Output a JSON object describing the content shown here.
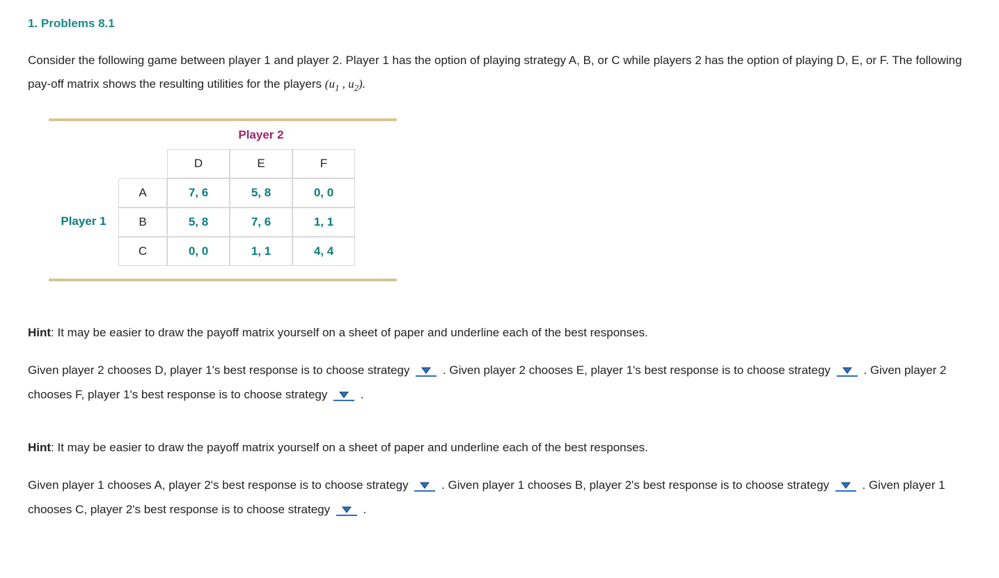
{
  "title": "1. Problems 8.1",
  "intro": {
    "part1": "Consider the following game between player 1 and player 2. Player 1 has the option of playing strategy A, B, or C while players 2 has the option of playing D, E, or F. The following pay-off matrix shows the resulting utilities for the players ",
    "math_open": "(",
    "u1": "u",
    "u1_sub": "1",
    "comma": " , ",
    "u2": "u",
    "u2_sub": "2",
    "math_close": ").",
    "part2": ""
  },
  "matrix": {
    "player1_label": "Player 1",
    "player2_label": "Player 2",
    "col_heads": [
      "D",
      "E",
      "F"
    ],
    "row_heads": [
      "A",
      "B",
      "C"
    ],
    "cells": [
      [
        "7, 6",
        "5, 8",
        "0, 0"
      ],
      [
        "5, 8",
        "7, 6",
        "1, 1"
      ],
      [
        "0, 0",
        "1, 1",
        "4, 4"
      ]
    ]
  },
  "hint1": {
    "label": "Hint",
    "text": ": It may be easier to draw the payoff matrix yourself on a sheet of paper and underline each of the best responses."
  },
  "q1": {
    "s1a": "Given player 2 chooses D, player 1's best response is to choose strategy ",
    "s1b": " . Given player 2 chooses E, player 1's best response is to choose strategy ",
    "s1c": " . Given player 2 chooses F, player 1's best response is to choose strategy ",
    "s1d": " ."
  },
  "hint2": {
    "label": "Hint",
    "text": ": It may be easier to draw the payoff matrix yourself on a sheet of paper and underline each of the best responses."
  },
  "q2": {
    "s1a": "Given player 1 chooses A, player 2's best response is to choose strategy ",
    "s1b": " . Given player 1 chooses B, player 2's best response is to choose strategy ",
    "s1c": " . Given player 1 chooses C, player 2's best response is to choose strategy ",
    "s1d": " ."
  },
  "icons": {
    "dropdown": "dropdown-arrow-icon"
  },
  "colors": {
    "teal": "#0c7d7d",
    "magenta": "#a0246b",
    "tan": "#d6c694",
    "dropdown": "#2a70c2"
  }
}
